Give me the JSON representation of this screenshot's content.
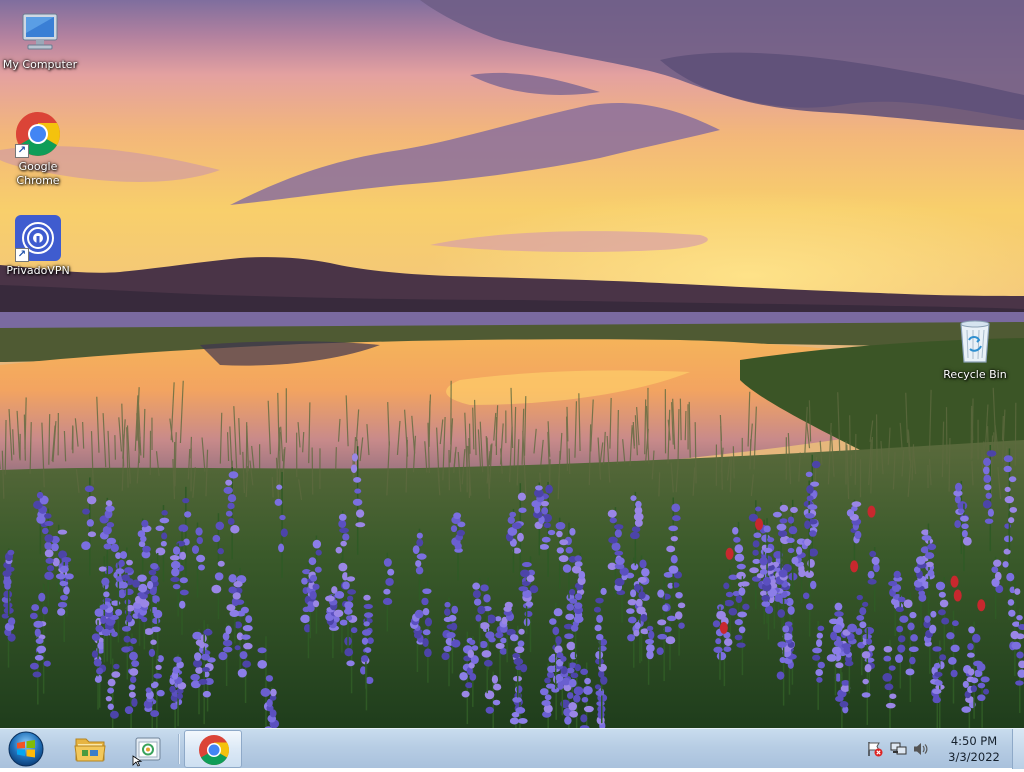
{
  "desktop": {
    "icons": [
      {
        "label": "My Computer",
        "icon": "computer-icon"
      },
      {
        "label": "Google Chrome",
        "label_line1": "Google",
        "label_line2": "Chrome",
        "icon": "chrome-icon"
      },
      {
        "label": "PrivadoVPN",
        "icon": "privadovpn-icon"
      },
      {
        "label": "Recycle Bin",
        "icon": "recycle-bin-icon"
      }
    ]
  },
  "taskbar": {
    "start": {
      "icon": "windows-logo-icon"
    },
    "pinned": [
      {
        "name": "file-explorer",
        "icon": "folder-icon"
      },
      {
        "name": "app-2",
        "icon": "app-window-icon"
      },
      {
        "name": "google-chrome",
        "icon": "chrome-icon",
        "active": true
      }
    ],
    "tray": {
      "icons": [
        "action-center-flag-icon",
        "network-icon",
        "volume-icon"
      ],
      "time": "4:50 PM",
      "date": "3/3/2022"
    }
  },
  "colors": {
    "taskbar": "#b7cde4",
    "chrome_red": "#db4437",
    "chrome_yellow": "#f4c20d",
    "chrome_green": "#0f9d58",
    "chrome_blue": "#4285f4",
    "privado_bg": "#3f5ccf"
  }
}
